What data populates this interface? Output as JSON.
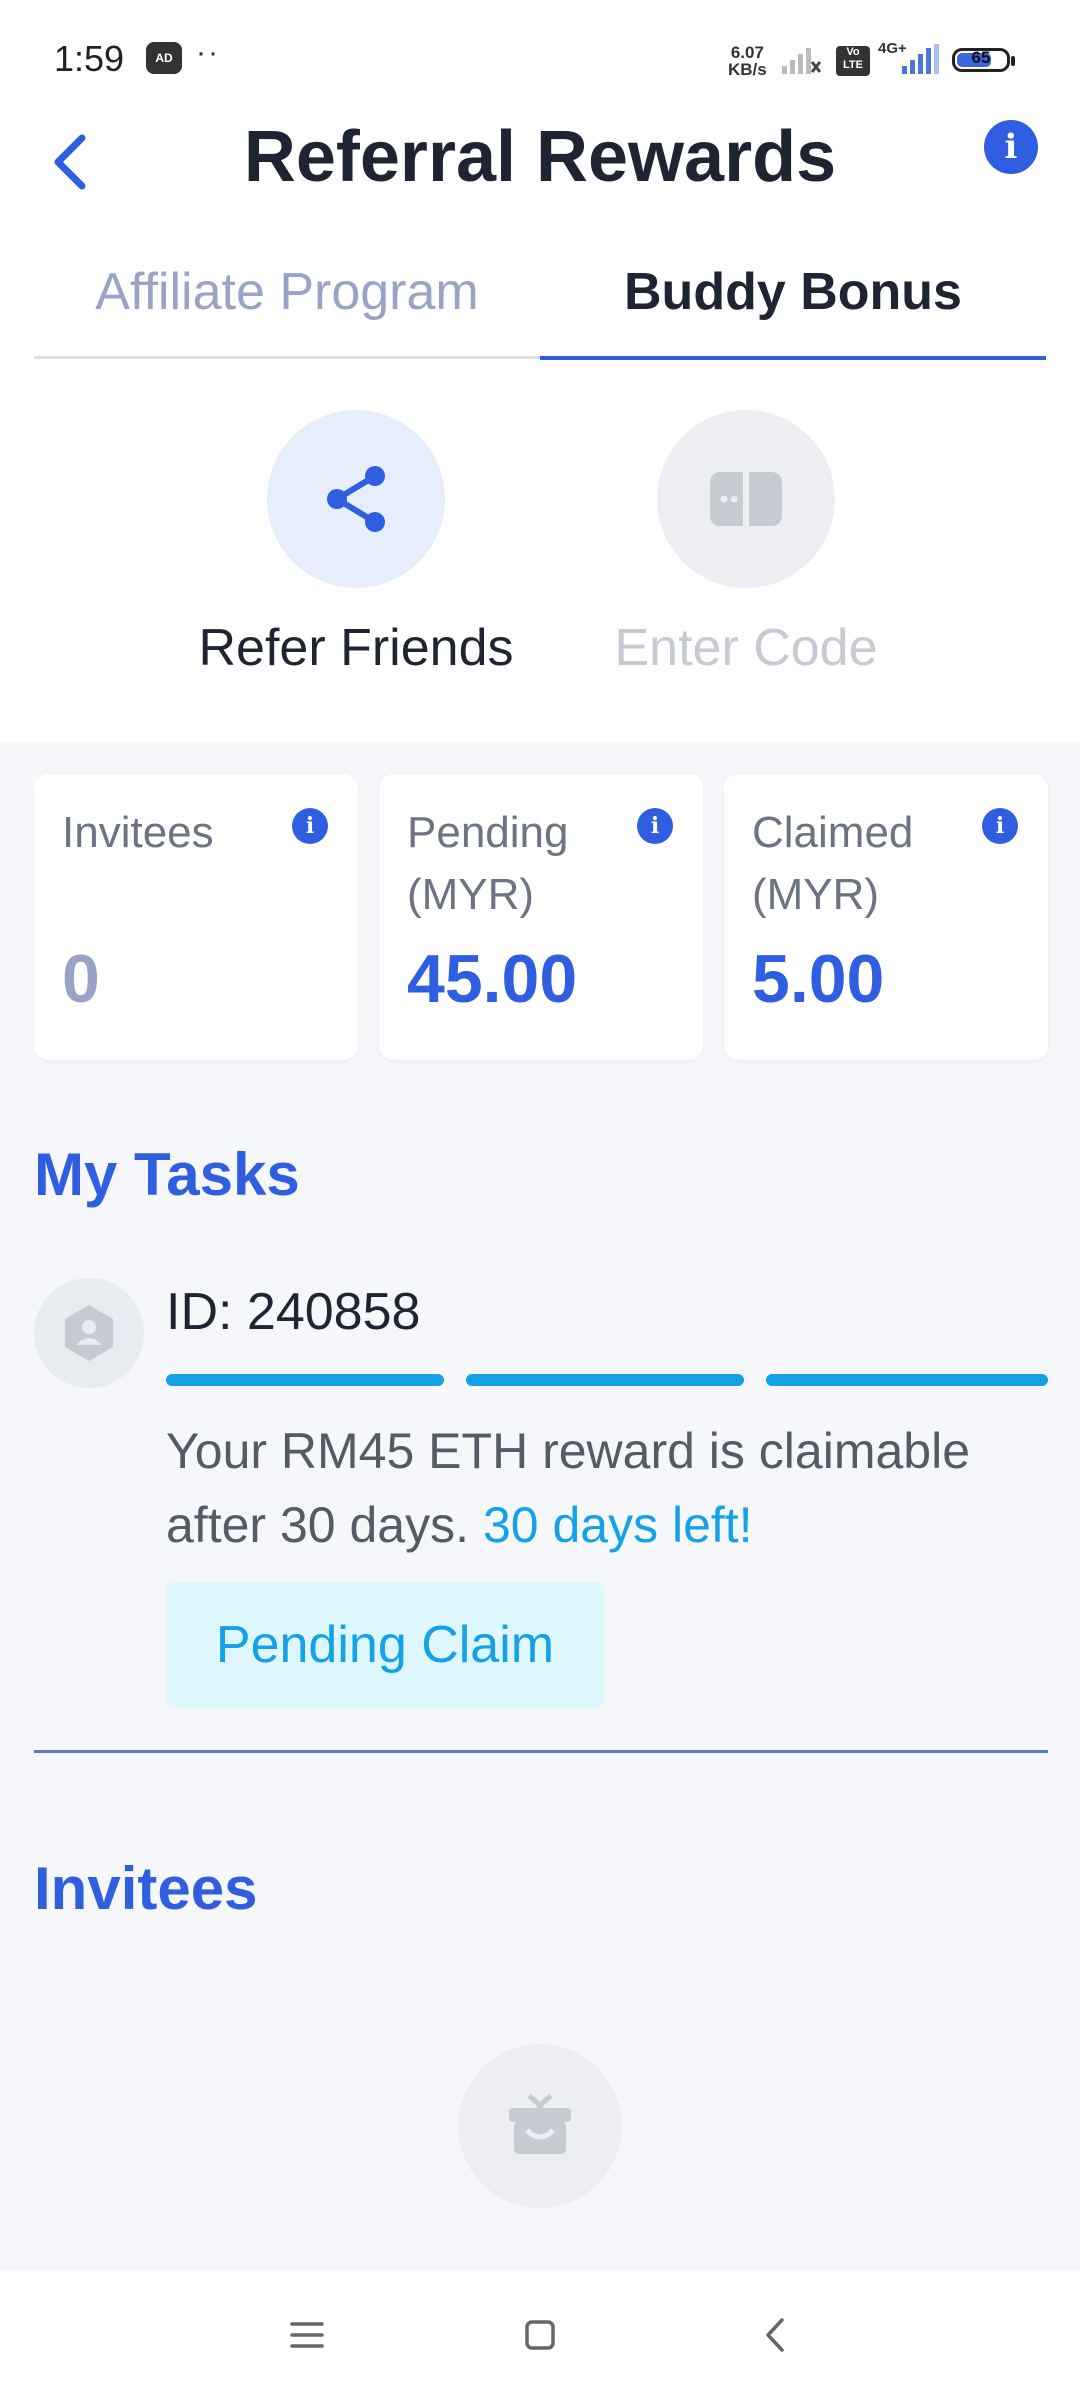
{
  "status_bar": {
    "time": "1:59",
    "ad_badge": "AD",
    "dots": "··",
    "speed_value": "6.07",
    "speed_unit": "KB/s",
    "volte": "Vo LTE",
    "network": "4G+",
    "battery": "65"
  },
  "header": {
    "title": "Referral Rewards",
    "info": "i"
  },
  "tabs": [
    {
      "label": "Affiliate Program"
    },
    {
      "label": "Buddy Bonus"
    }
  ],
  "actions": {
    "refer_label": "Refer Friends",
    "enter_label": "Enter Code"
  },
  "stats": [
    {
      "title": "Invitees",
      "value": "0",
      "value_color": "#9aa3c6",
      "info": "i"
    },
    {
      "title": "Pending (MYR)",
      "value": "45.00",
      "value_color": "#2f5fe0",
      "info": "i"
    },
    {
      "title": "Claimed (MYR)",
      "value": "5.00",
      "value_color": "#2f5fe0",
      "info": "i"
    }
  ],
  "tasks": {
    "heading": "My Tasks",
    "items": [
      {
        "id_text": "ID: 240858",
        "steps_completed": 3,
        "steps_total": 3,
        "description": "Your RM45 ETH reward is claimable after 30 days.",
        "days_left": "30 days left!",
        "button_label": "Pending Claim"
      }
    ]
  },
  "invitees": {
    "heading": "Invitees"
  },
  "colors": {
    "accent": "#2f5fe0",
    "progress": "#14a1e8",
    "muted": "#9aa3c6"
  },
  "icons": {
    "back": "chevron-left-icon",
    "share": "share-icon",
    "enter_code": "code-card-icon",
    "task_avatar": "user-shield-icon",
    "empty": "gift-icon"
  }
}
